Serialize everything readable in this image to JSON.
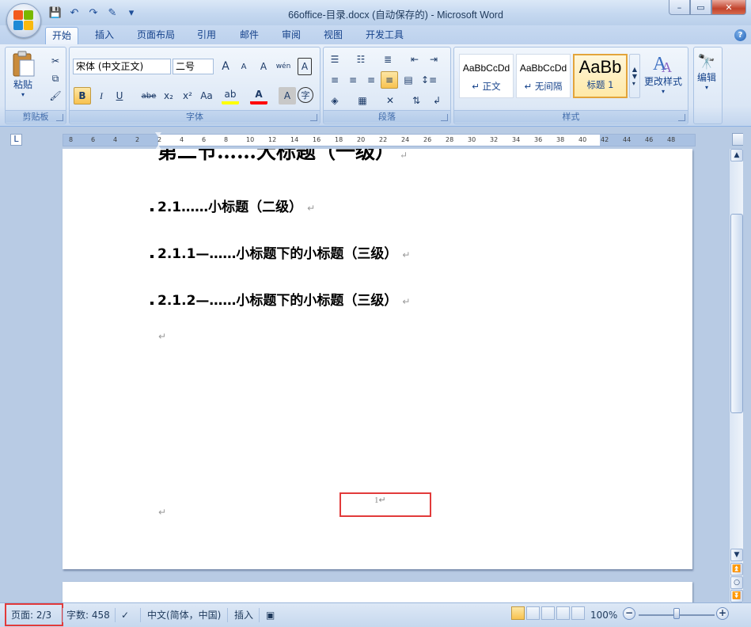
{
  "window": {
    "title": "66office-目录.docx (自动保存的) - Microsoft Word",
    "controls": {
      "minimize": "–",
      "restore": "▭",
      "close": "✕"
    }
  },
  "quick_access": {
    "save": "💾",
    "undo": "↶",
    "redo": "↷",
    "customize": "▾"
  },
  "tabs": [
    {
      "label": "开始",
      "active": true
    },
    {
      "label": "插入"
    },
    {
      "label": "页面布局"
    },
    {
      "label": "引用"
    },
    {
      "label": "邮件"
    },
    {
      "label": "审阅"
    },
    {
      "label": "视图"
    },
    {
      "label": "开发工具"
    }
  ],
  "ribbon": {
    "clipboard": {
      "label": "剪贴板",
      "paste": "粘贴"
    },
    "font": {
      "label": "字体",
      "font_name": "宋体 (中文正文)",
      "font_size": "二号",
      "grow": "A",
      "shrink": "A",
      "clear": "A",
      "phonetic": "wén",
      "border_char": "A",
      "bold": "B",
      "italic": "I",
      "underline": "U",
      "strike": "abe",
      "subscript": "x₂",
      "superscript": "x²",
      "case": "Aa",
      "highlight": "ab",
      "font_color": "A",
      "shading": "A",
      "enclose": "字"
    },
    "paragraph": {
      "label": "段落"
    },
    "styles": {
      "label": "样式",
      "cards": [
        {
          "preview": "AaBbCcDd",
          "name": "↵ 正文"
        },
        {
          "preview": "AaBbCcDd",
          "name": "↵ 无间隔"
        },
        {
          "preview": "AaBb",
          "name": "标题 1"
        }
      ],
      "change_styles": "更改样式"
    },
    "editing": {
      "label": "编辑"
    }
  },
  "ruler": {
    "ticks": [
      "8",
      "6",
      "4",
      "2",
      "2",
      "4",
      "6",
      "8",
      "10",
      "12",
      "14",
      "16",
      "18",
      "20",
      "22",
      "24",
      "26",
      "28",
      "30",
      "32",
      "34",
      "36",
      "38",
      "40",
      "42",
      "44",
      "46",
      "48"
    ]
  },
  "document": {
    "heading1": "第二节……大标题（一级）",
    "headings": [
      {
        "text": "2.1……小标题（二级）"
      },
      {
        "text": "2.1.1—……小标题下的小标题（三级）"
      },
      {
        "text": "2.1.2—……小标题下的小标题（三级）"
      }
    ],
    "para_mark": "↵",
    "footer_page_number": "1↵"
  },
  "status": {
    "page": "页面: 2/3",
    "words": "字数: 458",
    "language": "中文(简体，中国)",
    "mode": "插入",
    "zoom": "100%",
    "zoom_fraction": 0.5
  },
  "colors": {
    "highlight_box": "#e23a3a",
    "font_color_bar": "#ff0000",
    "highlight_color": "#ffff00"
  }
}
